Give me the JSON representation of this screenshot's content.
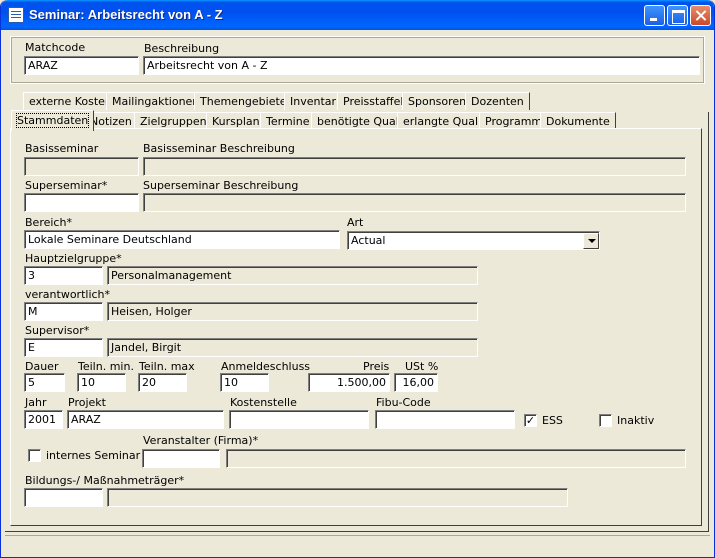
{
  "window": {
    "title": "Seminar: Arbeitsrecht von A - Z"
  },
  "header": {
    "matchcode_label": "Matchcode",
    "matchcode_value": "ARAZ",
    "beschreibung_label": "Beschreibung",
    "beschreibung_value": "Arbeitsrecht von A - Z"
  },
  "tabs_row1": [
    {
      "label": "externe Kosten"
    },
    {
      "label": "Mailingaktionen"
    },
    {
      "label": "Themengebiete"
    },
    {
      "label": "Inventar"
    },
    {
      "label": "Preisstaffel"
    },
    {
      "label": "Sponsoren"
    },
    {
      "label": "Dozenten"
    }
  ],
  "tabs_row2": [
    {
      "label": "Stammdaten",
      "active": true
    },
    {
      "label": "Notizen"
    },
    {
      "label": "Zielgruppen"
    },
    {
      "label": "Kursplan"
    },
    {
      "label": "Termine"
    },
    {
      "label": "benötigte Qual."
    },
    {
      "label": "erlangte Qual."
    },
    {
      "label": "Programm"
    },
    {
      "label": "Dokumente"
    }
  ],
  "form": {
    "basisseminar_label": "Basisseminar",
    "basisseminar_value": "",
    "basisseminar_beschreibung_label": "Basisseminar Beschreibung",
    "basisseminar_beschreibung_value": "",
    "superseminar_label": "Superseminar*",
    "superseminar_value": "",
    "superseminar_beschreibung_label": "Superseminar Beschreibung",
    "superseminar_beschreibung_value": "",
    "bereich_label": "Bereich*",
    "bereich_value": "Lokale Seminare Deutschland",
    "art_label": "Art",
    "art_value": "Actual",
    "hauptzielgruppe_label": "Hauptzielgruppe*",
    "hauptzielgruppe_code": "3",
    "hauptzielgruppe_name": "Personalmanagement",
    "verantwortlich_label": "verantwortlich*",
    "verantwortlich_code": "M",
    "verantwortlich_name": "Heisen, Holger",
    "supervisor_label": "Supervisor*",
    "supervisor_code": "E",
    "supervisor_name": "Jandel, Birgit",
    "dauer_label": "Dauer",
    "dauer_value": "5",
    "teiln_min_label": "Teiln. min.",
    "teiln_min_value": "10",
    "teiln_max_label": "Teiln. max",
    "teiln_max_value": "20",
    "anmeldeschluss_label": "Anmeldeschluss",
    "anmeldeschluss_value": "10",
    "preis_label": "Preis",
    "preis_value": "1.500,00",
    "ust_label": "USt %",
    "ust_value": "16,00",
    "jahr_label": "Jahr",
    "jahr_value": "2001",
    "projekt_label": "Projekt",
    "projekt_value": "ARAZ",
    "kostenstelle_label": "Kostenstelle",
    "kostenstelle_value": "",
    "fibu_label": "Fibu-Code",
    "fibu_value": "",
    "ess_label": "ESS",
    "ess_mark": "✓",
    "inaktiv_label": "Inaktiv",
    "inaktiv_mark": "",
    "internes_label": "internes Seminar",
    "internes_mark": "",
    "veranstalter_label": "Veranstalter (Firma)*",
    "veranstalter_code": "",
    "veranstalter_name": "",
    "bildungstraeger_label": "Bildungs-/ Maßnahmeträger*",
    "bildungstraeger_code": "",
    "bildungstraeger_name": ""
  }
}
